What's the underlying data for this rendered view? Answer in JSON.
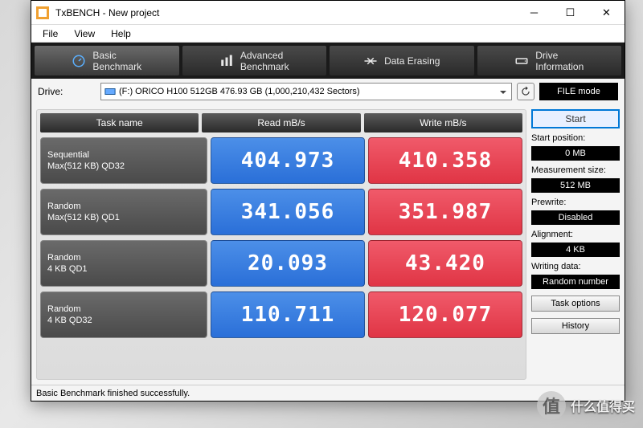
{
  "window": {
    "title": "TxBENCH - New project"
  },
  "menu": {
    "file": "File",
    "view": "View",
    "help": "Help"
  },
  "tabs": {
    "basic": "Basic\nBenchmark",
    "advanced": "Advanced\nBenchmark",
    "erase": "Data Erasing",
    "drive": "Drive\nInformation"
  },
  "drive": {
    "label": "Drive:",
    "value": "(F:) ORICO H100 512GB  476.93 GB (1,000,210,432 Sectors)",
    "filemode": "FILE mode"
  },
  "headers": {
    "task": "Task name",
    "read": "Read mB/s",
    "write": "Write mB/s"
  },
  "rows": [
    {
      "name1": "Sequential",
      "name2": "Max(512 KB) QD32",
      "read": "404.973",
      "write": "410.358"
    },
    {
      "name1": "Random",
      "name2": "Max(512 KB) QD1",
      "read": "341.056",
      "write": "351.987"
    },
    {
      "name1": "Random",
      "name2": "4 KB QD1",
      "read": "20.093",
      "write": "43.420"
    },
    {
      "name1": "Random",
      "name2": "4 KB QD32",
      "read": "110.711",
      "write": "120.077"
    }
  ],
  "side": {
    "start": "Start",
    "startpos_l": "Start position:",
    "startpos_v": "0 MB",
    "msize_l": "Measurement size:",
    "msize_v": "512 MB",
    "prew_l": "Prewrite:",
    "prew_v": "Disabled",
    "align_l": "Alignment:",
    "align_v": "4 KB",
    "wdata_l": "Writing data:",
    "wdata_v": "Random number",
    "taskopt": "Task options",
    "history": "History"
  },
  "status": "Basic Benchmark finished successfully.",
  "watermark": {
    "glyph": "值",
    "text": "什么值得买"
  },
  "chart_data": {
    "type": "table",
    "title": "TxBENCH Basic Benchmark",
    "columns": [
      "Task name",
      "Read mB/s",
      "Write mB/s"
    ],
    "rows": [
      [
        "Sequential Max(512 KB) QD32",
        404.973,
        410.358
      ],
      [
        "Random Max(512 KB) QD1",
        341.056,
        351.987
      ],
      [
        "Random 4 KB QD1",
        20.093,
        43.42
      ],
      [
        "Random 4 KB QD32",
        110.711,
        120.077
      ]
    ]
  }
}
